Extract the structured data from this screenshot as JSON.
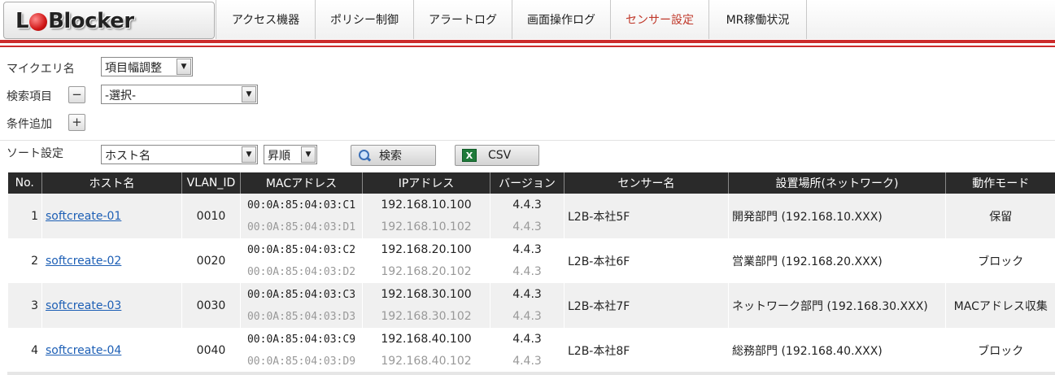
{
  "app": {
    "logo_text": "L2Blocker"
  },
  "nav": {
    "items": [
      {
        "label": "アクセス機器"
      },
      {
        "label": "ポリシー制御"
      },
      {
        "label": "アラートログ"
      },
      {
        "label": "画面操作ログ"
      },
      {
        "label": "センサー設定"
      },
      {
        "label": "MR稼働状況"
      }
    ],
    "active": "センサー設定",
    "active_color": "#c0392b"
  },
  "form": {
    "myquery_label": "マイクエリ名",
    "myquery_value": "項目幅調整",
    "search_item_label": "検索項目",
    "search_item_value": "-選択-",
    "remove_symbol": "−",
    "add_condition_label": "条件追加",
    "add_symbol": "+",
    "sort_label": "ソート設定",
    "sort_field_value": "ホスト名",
    "sort_order_value": "昇順",
    "search_button": "検索",
    "csv_button": "CSV"
  },
  "table": {
    "headers": [
      "No.",
      "ホスト名",
      "VLAN_ID",
      "MACアドレス",
      "IPアドレス",
      "バージョン",
      "センサー名",
      "設置場所(ネットワーク)",
      "動作モード"
    ],
    "rows": [
      {
        "no": "1",
        "host": "softcreate-01",
        "vlan": "0010",
        "mac1": "00:0A:85:04:03:C1",
        "mac2": "00:0A:85:04:03:D1",
        "ip1": "192.168.10.100",
        "ip2": "192.168.10.102",
        "ver1": "4.4.3",
        "ver2": "4.4.3",
        "sensor": "L2B-本社5F",
        "location": "開発部門 (192.168.10.XXX)",
        "mode": "保留"
      },
      {
        "no": "2",
        "host": "softcreate-02",
        "vlan": "0020",
        "mac1": "00:0A:85:04:03:C2",
        "mac2": "00:0A:85:04:03:D2",
        "ip1": "192.168.20.100",
        "ip2": "192.168.20.102",
        "ver1": "4.4.3",
        "ver2": "4.4.3",
        "sensor": "L2B-本社6F",
        "location": "営業部門 (192.168.20.XXX)",
        "mode": "ブロック"
      },
      {
        "no": "3",
        "host": "softcreate-03",
        "vlan": "0030",
        "mac1": "00:0A:85:04:03:C3",
        "mac2": "00:0A:85:04:03:D3",
        "ip1": "192.168.30.100",
        "ip2": "192.168.30.102",
        "ver1": "4.4.3",
        "ver2": "4.4.3",
        "sensor": "L2B-本社7F",
        "location": "ネットワーク部門 (192.168.30.XXX)",
        "mode": "MACアドレス収集"
      },
      {
        "no": "4",
        "host": "softcreate-04",
        "vlan": "0040",
        "mac1": "00:0A:85:04:03:C9",
        "mac2": "00:0A:85:04:03:D9",
        "ip1": "192.168.40.100",
        "ip2": "192.168.40.102",
        "ver1": "4.4.3",
        "ver2": "4.4.3",
        "sensor": "L2B-本社8F",
        "location": "総務部門 (192.168.40.XXX)",
        "mode": "ブロック"
      }
    ]
  },
  "icons": {
    "search": "magnifier-icon",
    "csv": "excel-icon",
    "dropdown": "triangle-down-icon"
  },
  "colors": {
    "brand_red": "#cc2b2b",
    "link_blue": "#1d5fb5",
    "header_dark": "#2a2a2a"
  }
}
